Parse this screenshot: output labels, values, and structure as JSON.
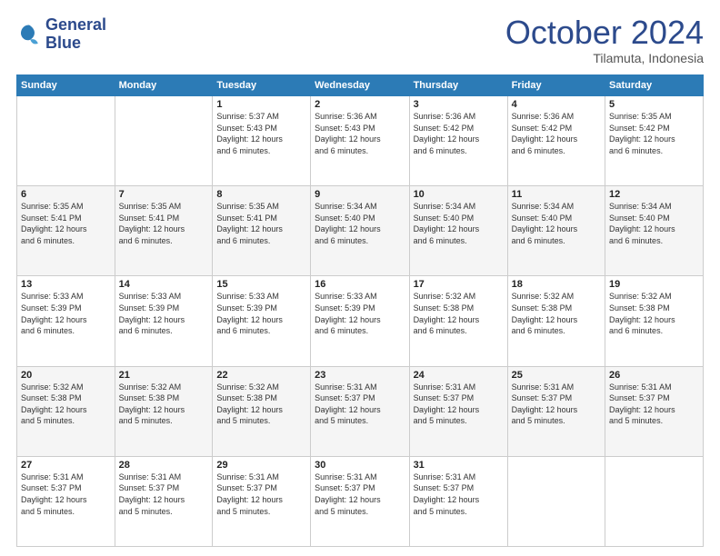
{
  "logo": {
    "line1": "General",
    "line2": "Blue"
  },
  "header": {
    "month": "October 2024",
    "location": "Tilamuta, Indonesia"
  },
  "weekdays": [
    "Sunday",
    "Monday",
    "Tuesday",
    "Wednesday",
    "Thursday",
    "Friday",
    "Saturday"
  ],
  "weeks": [
    [
      {
        "day": "",
        "detail": ""
      },
      {
        "day": "",
        "detail": ""
      },
      {
        "day": "1",
        "detail": "Sunrise: 5:37 AM\nSunset: 5:43 PM\nDaylight: 12 hours\nand 6 minutes."
      },
      {
        "day": "2",
        "detail": "Sunrise: 5:36 AM\nSunset: 5:43 PM\nDaylight: 12 hours\nand 6 minutes."
      },
      {
        "day": "3",
        "detail": "Sunrise: 5:36 AM\nSunset: 5:42 PM\nDaylight: 12 hours\nand 6 minutes."
      },
      {
        "day": "4",
        "detail": "Sunrise: 5:36 AM\nSunset: 5:42 PM\nDaylight: 12 hours\nand 6 minutes."
      },
      {
        "day": "5",
        "detail": "Sunrise: 5:35 AM\nSunset: 5:42 PM\nDaylight: 12 hours\nand 6 minutes."
      }
    ],
    [
      {
        "day": "6",
        "detail": "Sunrise: 5:35 AM\nSunset: 5:41 PM\nDaylight: 12 hours\nand 6 minutes."
      },
      {
        "day": "7",
        "detail": "Sunrise: 5:35 AM\nSunset: 5:41 PM\nDaylight: 12 hours\nand 6 minutes."
      },
      {
        "day": "8",
        "detail": "Sunrise: 5:35 AM\nSunset: 5:41 PM\nDaylight: 12 hours\nand 6 minutes."
      },
      {
        "day": "9",
        "detail": "Sunrise: 5:34 AM\nSunset: 5:40 PM\nDaylight: 12 hours\nand 6 minutes."
      },
      {
        "day": "10",
        "detail": "Sunrise: 5:34 AM\nSunset: 5:40 PM\nDaylight: 12 hours\nand 6 minutes."
      },
      {
        "day": "11",
        "detail": "Sunrise: 5:34 AM\nSunset: 5:40 PM\nDaylight: 12 hours\nand 6 minutes."
      },
      {
        "day": "12",
        "detail": "Sunrise: 5:34 AM\nSunset: 5:40 PM\nDaylight: 12 hours\nand 6 minutes."
      }
    ],
    [
      {
        "day": "13",
        "detail": "Sunrise: 5:33 AM\nSunset: 5:39 PM\nDaylight: 12 hours\nand 6 minutes."
      },
      {
        "day": "14",
        "detail": "Sunrise: 5:33 AM\nSunset: 5:39 PM\nDaylight: 12 hours\nand 6 minutes."
      },
      {
        "day": "15",
        "detail": "Sunrise: 5:33 AM\nSunset: 5:39 PM\nDaylight: 12 hours\nand 6 minutes."
      },
      {
        "day": "16",
        "detail": "Sunrise: 5:33 AM\nSunset: 5:39 PM\nDaylight: 12 hours\nand 6 minutes."
      },
      {
        "day": "17",
        "detail": "Sunrise: 5:32 AM\nSunset: 5:38 PM\nDaylight: 12 hours\nand 6 minutes."
      },
      {
        "day": "18",
        "detail": "Sunrise: 5:32 AM\nSunset: 5:38 PM\nDaylight: 12 hours\nand 6 minutes."
      },
      {
        "day": "19",
        "detail": "Sunrise: 5:32 AM\nSunset: 5:38 PM\nDaylight: 12 hours\nand 6 minutes."
      }
    ],
    [
      {
        "day": "20",
        "detail": "Sunrise: 5:32 AM\nSunset: 5:38 PM\nDaylight: 12 hours\nand 5 minutes."
      },
      {
        "day": "21",
        "detail": "Sunrise: 5:32 AM\nSunset: 5:38 PM\nDaylight: 12 hours\nand 5 minutes."
      },
      {
        "day": "22",
        "detail": "Sunrise: 5:32 AM\nSunset: 5:38 PM\nDaylight: 12 hours\nand 5 minutes."
      },
      {
        "day": "23",
        "detail": "Sunrise: 5:31 AM\nSunset: 5:37 PM\nDaylight: 12 hours\nand 5 minutes."
      },
      {
        "day": "24",
        "detail": "Sunrise: 5:31 AM\nSunset: 5:37 PM\nDaylight: 12 hours\nand 5 minutes."
      },
      {
        "day": "25",
        "detail": "Sunrise: 5:31 AM\nSunset: 5:37 PM\nDaylight: 12 hours\nand 5 minutes."
      },
      {
        "day": "26",
        "detail": "Sunrise: 5:31 AM\nSunset: 5:37 PM\nDaylight: 12 hours\nand 5 minutes."
      }
    ],
    [
      {
        "day": "27",
        "detail": "Sunrise: 5:31 AM\nSunset: 5:37 PM\nDaylight: 12 hours\nand 5 minutes."
      },
      {
        "day": "28",
        "detail": "Sunrise: 5:31 AM\nSunset: 5:37 PM\nDaylight: 12 hours\nand 5 minutes."
      },
      {
        "day": "29",
        "detail": "Sunrise: 5:31 AM\nSunset: 5:37 PM\nDaylight: 12 hours\nand 5 minutes."
      },
      {
        "day": "30",
        "detail": "Sunrise: 5:31 AM\nSunset: 5:37 PM\nDaylight: 12 hours\nand 5 minutes."
      },
      {
        "day": "31",
        "detail": "Sunrise: 5:31 AM\nSunset: 5:37 PM\nDaylight: 12 hours\nand 5 minutes."
      },
      {
        "day": "",
        "detail": ""
      },
      {
        "day": "",
        "detail": ""
      }
    ]
  ]
}
